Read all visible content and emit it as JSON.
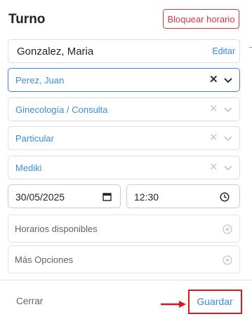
{
  "header": {
    "title": "Turno",
    "block_button": "Bloquear horario"
  },
  "patient": {
    "name": "Gonzalez, Maria",
    "edit_label": "Editar"
  },
  "selects": [
    {
      "value": "Perez, Juan",
      "active": true
    },
    {
      "value": "Ginecología / Consulta",
      "active": false
    },
    {
      "value": "Particular",
      "active": false
    },
    {
      "value": "Mediki",
      "active": false
    }
  ],
  "date_input": {
    "value": "30/05/2025",
    "icon": "calendar-icon"
  },
  "time_input": {
    "value": "12:30",
    "icon": "clock-icon"
  },
  "collapsibles": [
    {
      "label": "Horarios disponibles",
      "icon": "plus-circle-icon"
    },
    {
      "label": "Más Opciones",
      "icon": "plus-circle-icon"
    }
  ],
  "footer": {
    "close_label": "Cerrar",
    "save_label": "Guardar"
  },
  "colors": {
    "accent": "#2f8ee0",
    "danger": "#dc3545",
    "highlight": "#e0161e"
  }
}
